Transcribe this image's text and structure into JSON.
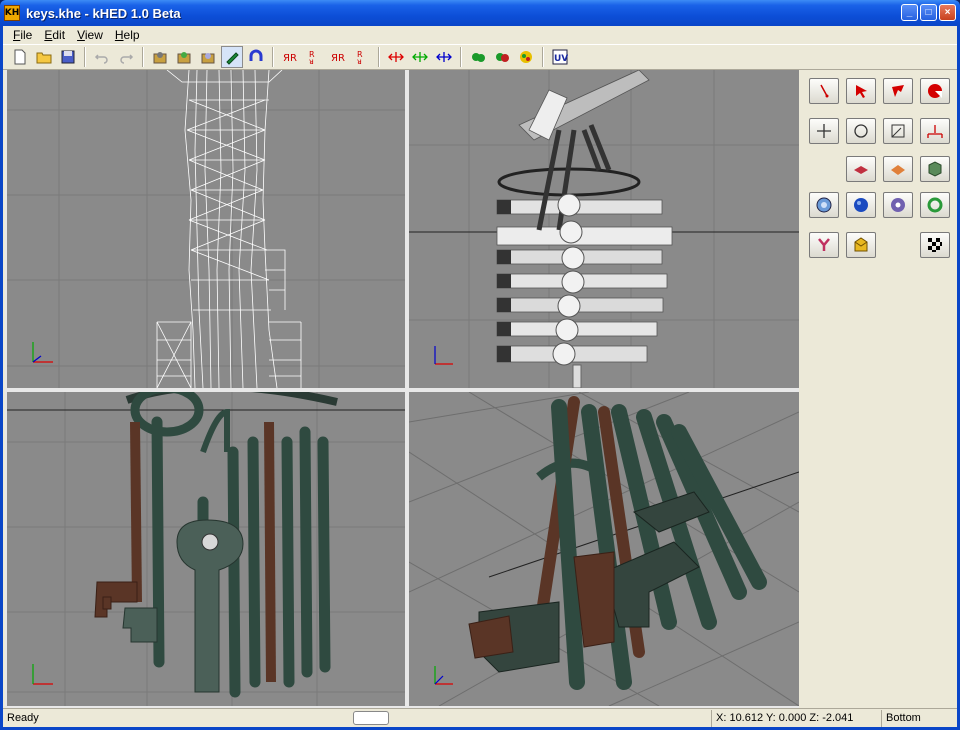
{
  "window": {
    "icon_text": "KH",
    "title": "keys.khe - kHED 1.0 Beta",
    "minimize": "_",
    "maximize": "□",
    "close": "×"
  },
  "menu": [
    {
      "label": "File",
      "accel": "F"
    },
    {
      "label": "Edit",
      "accel": "E"
    },
    {
      "label": "View",
      "accel": "V"
    },
    {
      "label": "Help",
      "accel": "H"
    }
  ],
  "toolbar": {
    "uv_label": "UV"
  },
  "status": {
    "text": "Ready",
    "coords": "X: 10.612 Y: 0.000 Z: -2.041",
    "view": "Bottom"
  },
  "colors": {
    "viewport_bg": "#8a8a8a",
    "grid": "#7b7b7b",
    "key_iron": "#2f4a40",
    "key_rust": "#5a3526",
    "accent_red": "#d40000"
  }
}
